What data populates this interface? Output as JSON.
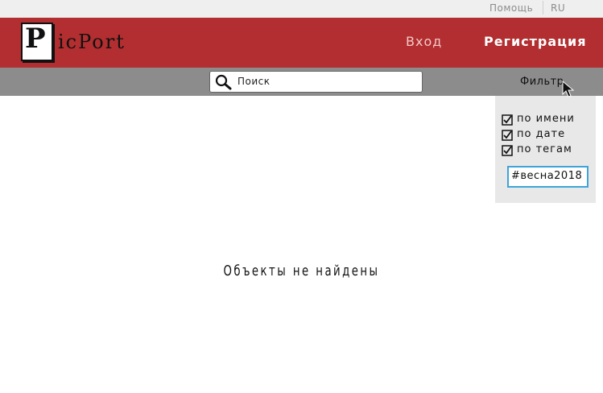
{
  "topbar": {
    "help_label": "Помощь",
    "lang_label": "RU"
  },
  "header": {
    "logo_initial": "P",
    "logo_rest": "icPort",
    "login_label": "Вход",
    "register_label": "Регистрация",
    "brand_color": "#b22e30"
  },
  "search": {
    "placeholder": "Поиск",
    "value": "",
    "filter_label": "Фильтр"
  },
  "filters": {
    "options": [
      {
        "label": "по имени",
        "checked": true
      },
      {
        "label": "по дате",
        "checked": true
      },
      {
        "label": "по тегам",
        "checked": true
      }
    ],
    "tag_value": "#весна2018"
  },
  "main": {
    "empty_message": "Объекты не найдены"
  }
}
